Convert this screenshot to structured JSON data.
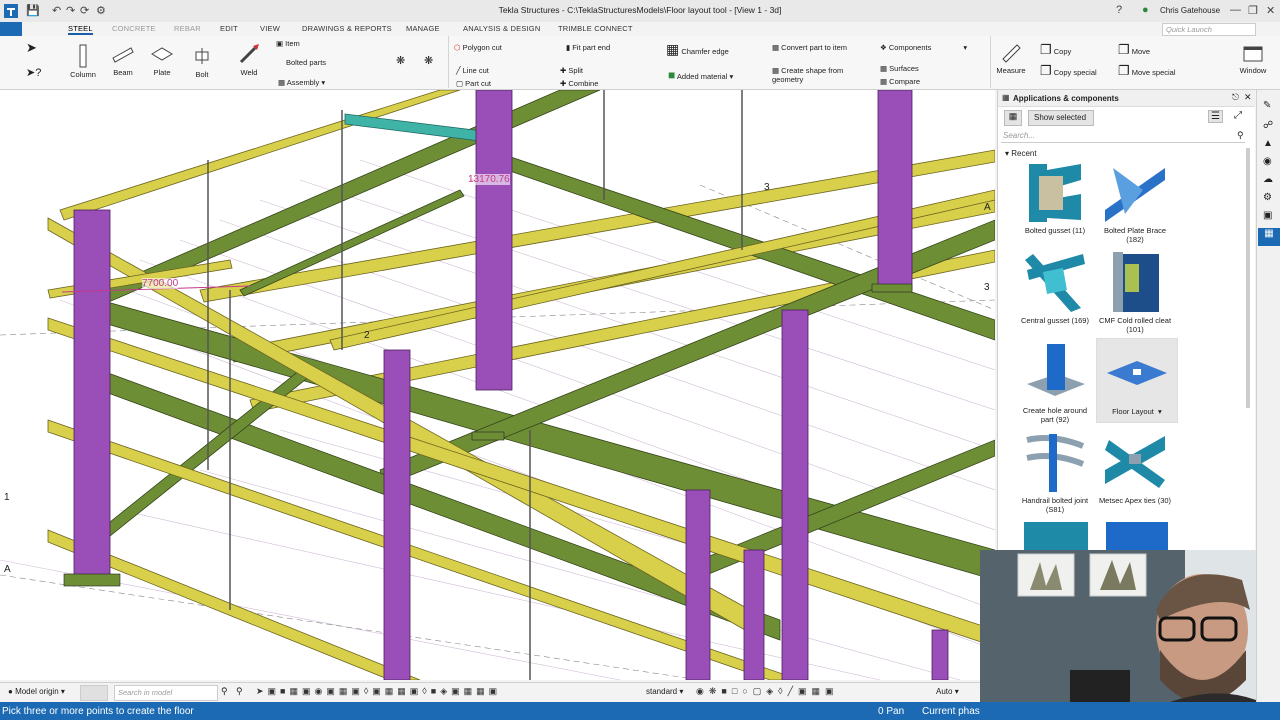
{
  "window": {
    "title": "Tekla Structures - C:\\TeklaStructuresModels\\Floor layout tool - [View 1 - 3d]",
    "user": "Chris Gatehouse",
    "quick_launch_placeholder": "Quick Launch"
  },
  "tabs": [
    {
      "label": "STEEL"
    },
    {
      "label": "CONCRETE"
    },
    {
      "label": "REBAR"
    },
    {
      "label": "EDIT"
    },
    {
      "label": "VIEW"
    },
    {
      "label": "DRAWINGS & REPORTS"
    },
    {
      "label": "MANAGE"
    },
    {
      "label": "ANALYSIS & DESIGN"
    },
    {
      "label": "TRIMBLE CONNECT"
    }
  ],
  "ribbon": {
    "column": "Column",
    "beam": "Beam",
    "plate": "Plate",
    "bolt": "Bolt",
    "weld": "Weld",
    "item": "Item",
    "bolted_parts": "Bolted parts",
    "assembly": "Assembly",
    "polygon_cut": "Polygon cut",
    "line_cut": "Line cut",
    "part_cut": "Part cut",
    "fit_part_end": "Fit part end",
    "split": "Split",
    "combine": "Combine",
    "chamfer_edge": "Chamfer edge",
    "added_material": "Added material",
    "convert_part": "Convert part to item",
    "create_shape": "Create shape from geometry",
    "components": "Components",
    "surfaces": "Surfaces",
    "compare": "Compare",
    "measure": "Measure",
    "copy": "Copy",
    "copy_special": "Copy special",
    "move": "Move",
    "move_special": "Move special",
    "window": "Window"
  },
  "panel": {
    "title": "Applications & components",
    "show_selected": "Show selected",
    "search_placeholder": "Search...",
    "recent": "Recent",
    "items": [
      {
        "label": "Bolted gusset (11)"
      },
      {
        "label": "Bolted Plate Brace (182)"
      },
      {
        "label": "Central gusset (169)"
      },
      {
        "label": "CMF Cold rolled cleat (101)"
      },
      {
        "label": "Create hole around part (92)"
      },
      {
        "label": "Floor Layout"
      },
      {
        "label": "Handrail bolted joint (S81)"
      },
      {
        "label": "Metsec Apex ties (30)"
      }
    ]
  },
  "viewport": {
    "dim1": "7700.00",
    "dim2": "13170.76",
    "gridlabels": [
      "1",
      "2",
      "3",
      "3",
      "A",
      "A"
    ]
  },
  "bottombar": {
    "model_origin": "Model origin",
    "search_placeholder": "Search in model",
    "standard": "standard",
    "auto": "Auto"
  },
  "status": {
    "prompt": "Pick three or more points to create the floor",
    "pan": "0 Pan",
    "phase": "Current phas"
  },
  "colors": {
    "accent": "#1c6ab3",
    "column": "#9a4fb8",
    "beam_green": "#6e8e36",
    "beam_yellow": "#d8cf4a",
    "brace_teal": "#3fb3a6"
  }
}
